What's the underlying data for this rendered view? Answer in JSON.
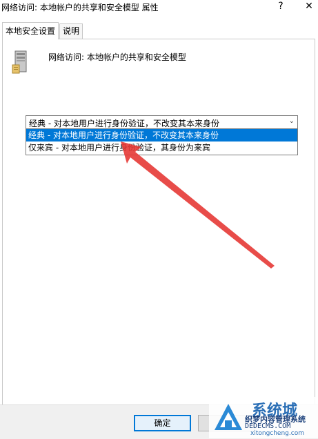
{
  "window": {
    "title": "网络访问: 本地帐户的共享和安全模型 属性",
    "help_glyph": "?",
    "close_glyph": "✕"
  },
  "tabs": [
    {
      "label": "本地安全设置",
      "active": true
    },
    {
      "label": "说明",
      "active": false
    }
  ],
  "policy": {
    "icon": "server-icon",
    "title": "网络访问: 本地帐户的共享和安全模型"
  },
  "combo": {
    "value": "经典 - 对本地用户进行身份验证，不改变其本来身份",
    "chevron": "⌄",
    "options": [
      {
        "label": "经典 - 对本地用户进行身份验证，不改变其本来身份",
        "selected": true
      },
      {
        "label": "仅来宾 - 对本地用户进行身份验证，其身份为来宾",
        "selected": false
      }
    ]
  },
  "footer": {
    "ok_label": "确定",
    "cancel_label": ""
  },
  "watermark": {
    "big_text": "系统城",
    "line1": "织梦内容管理系统",
    "line2": "DEDECMS.COM",
    "line3": "xitongcheng.com"
  },
  "colors": {
    "selection": "#0078d7",
    "arrow": "#e53935"
  }
}
